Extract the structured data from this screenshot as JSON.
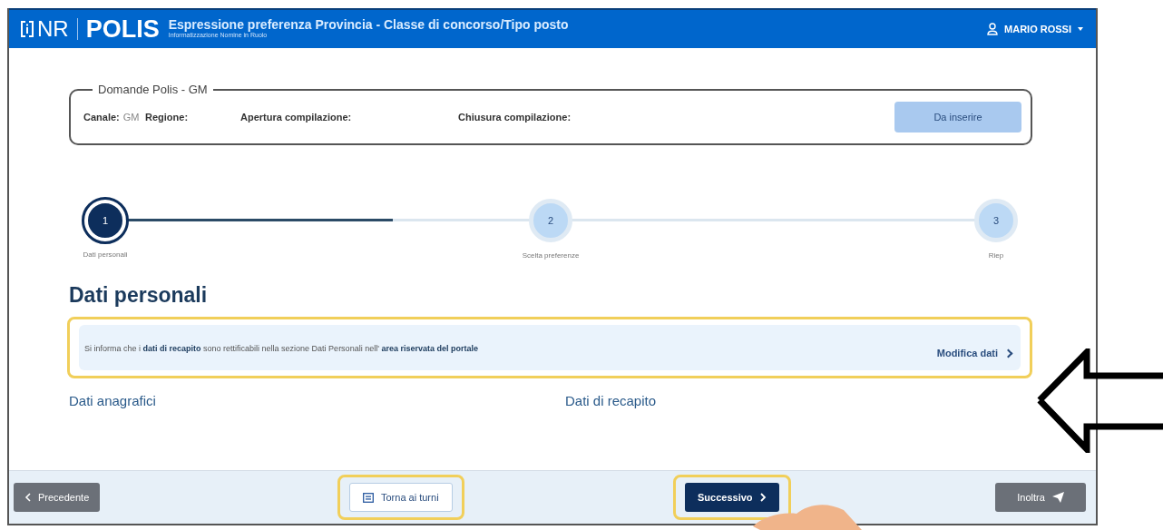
{
  "header": {
    "logo_left": "NR",
    "logo_right": "POLIS",
    "title": "Espressione preferenza Provincia - Classe di concorso/Tipo posto",
    "subtitle": "Informatizzazione Nomine in Ruolo",
    "user": "MARIO ROSSI"
  },
  "summary": {
    "legend": "Domande Polis - GM",
    "fields": [
      {
        "label": "Canale:",
        "value": "GM"
      },
      {
        "label": "Regione:"
      },
      {
        "label": "Apertura compilazione:"
      },
      {
        "label": "Chiusura compilazione:"
      }
    ],
    "status_button": "Da inserire"
  },
  "stepper": {
    "connectors": [
      {
        "level": 0.66
      },
      {
        "level": 0
      }
    ],
    "steps": [
      {
        "number": "1",
        "label": "Dati personali",
        "selected": true
      },
      {
        "number": "2",
        "label": "Scelta preferenze",
        "selected": false
      },
      {
        "number": "3",
        "label": "Riep",
        "selected": false
      }
    ]
  },
  "section_title": "Dati personali",
  "notice": {
    "text": "Si informa che i **dati di recapito** sono rettificabili nella sezione Dati Personali nell' **area riservata del portale**",
    "link": "Modifica dati",
    "highlighted": true
  },
  "subsections": [
    "Dati anagrafici",
    "Dati di recapito"
  ],
  "footer_buttons": [
    {
      "label": "Precedente",
      "kind": "secondary",
      "highlighted": false
    },
    {
      "label": "Torna ai turni",
      "kind": "outline",
      "highlighted": true
    },
    {
      "label": "Successivo",
      "kind": "primary",
      "highlighted": true
    },
    {
      "label": "Inoltra",
      "kind": "secondary",
      "highlighted": false
    }
  ]
}
